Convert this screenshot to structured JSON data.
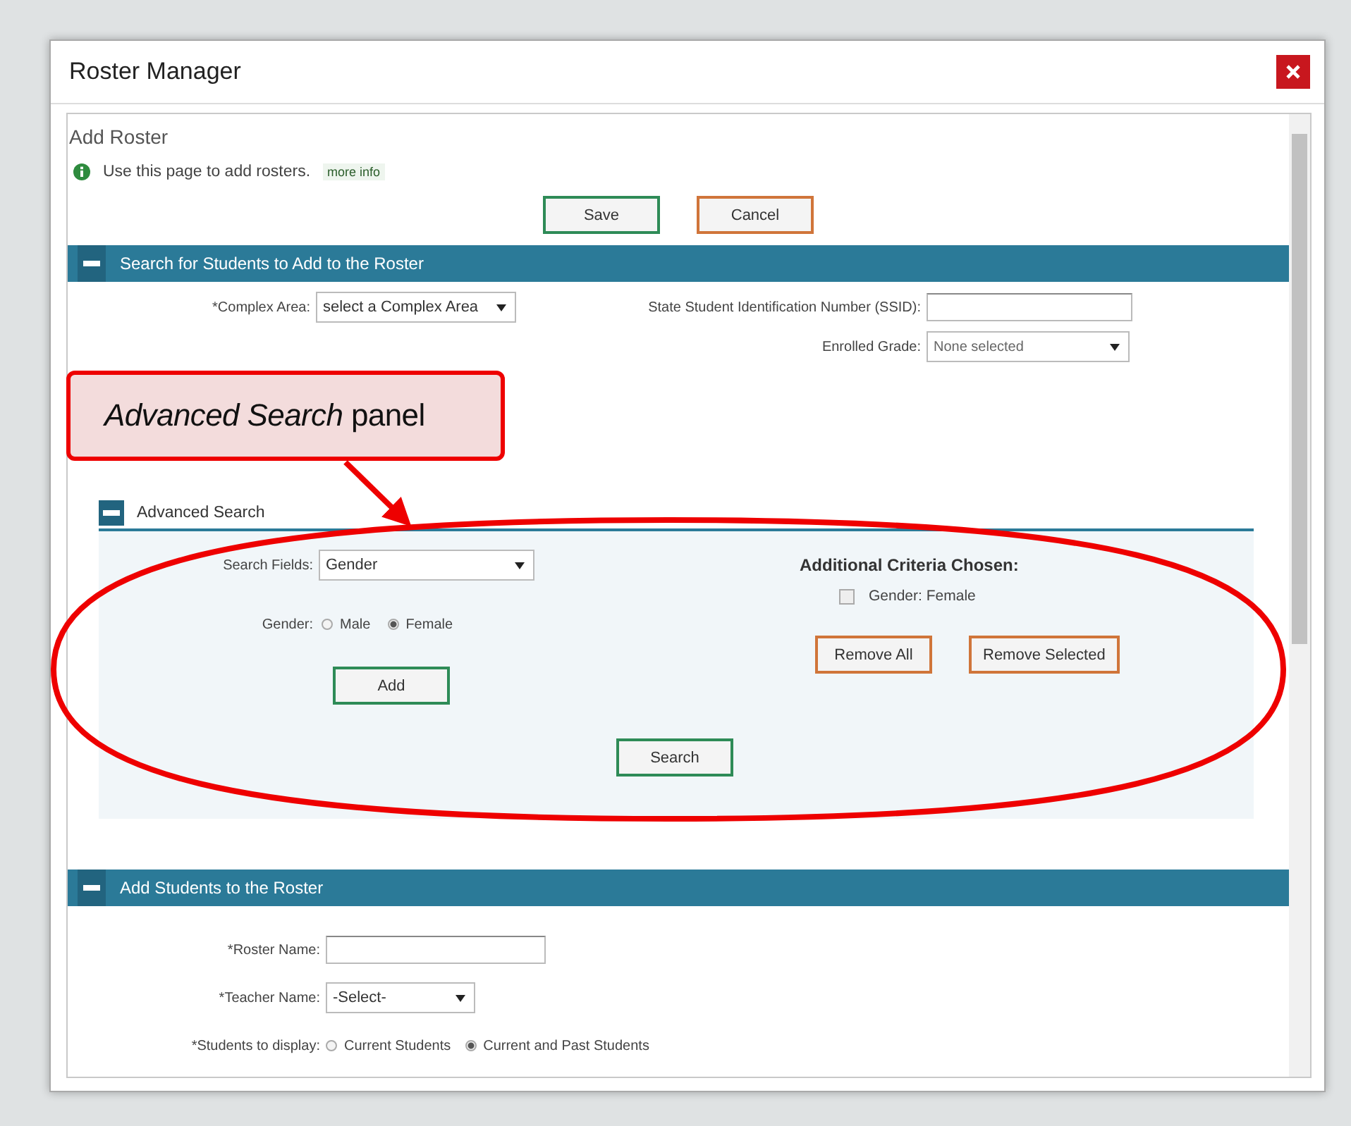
{
  "modal": {
    "title": "Roster Manager"
  },
  "page": {
    "heading": "Add Roster",
    "info": "Use this page to add rosters.",
    "more_info": "more info",
    "buttons": [
      {
        "label": "Save",
        "kind": "confirm"
      },
      {
        "label": "Cancel",
        "kind": "cancel"
      }
    ]
  },
  "search_section": {
    "title": "Search for Students to Add to the Roster",
    "expanded": true,
    "left_fields": [
      {
        "label": "*Complex Area:",
        "kind": "select",
        "value": "select a Complex Area"
      }
    ],
    "right_fields": [
      {
        "label": "State Student Identification Number (SSID):",
        "kind": "input"
      },
      {
        "label": "Enrolled Grade:",
        "kind": "select",
        "value": "None selected"
      }
    ],
    "advanced": {
      "title": "Advanced Search",
      "expanded": true,
      "search_field": {
        "label": "Search Fields:",
        "value": "Gender"
      },
      "gender": {
        "label": "Gender:",
        "options": [
          {
            "label": "Male",
            "selected": false
          },
          {
            "label": "Female",
            "selected": true
          }
        ]
      },
      "add_button": {
        "label": "Add",
        "kind": "confirm"
      },
      "criteria_title": "Additional Criteria Chosen:",
      "criteria": [
        {
          "label": "Gender: Female",
          "checked": false
        }
      ],
      "criteria_buttons": [
        {
          "label": "Remove All",
          "kind": "cancel"
        },
        {
          "label": "Remove Selected",
          "kind": "cancel"
        }
      ],
      "search_button": {
        "label": "Search",
        "kind": "confirm"
      }
    }
  },
  "add_section": {
    "title": "Add Students to the Roster",
    "expanded": true,
    "roster_name": {
      "label": "*Roster Name:"
    },
    "teacher_name": {
      "label": "*Teacher Name:",
      "value": "-Select-"
    },
    "students": {
      "label": "*Students to display:",
      "options": [
        {
          "label": "Current Students",
          "selected": false
        },
        {
          "label": "Current and Past Students",
          "selected": true
        }
      ]
    }
  },
  "annotation": {
    "text": "*Advanced Search* panel"
  }
}
